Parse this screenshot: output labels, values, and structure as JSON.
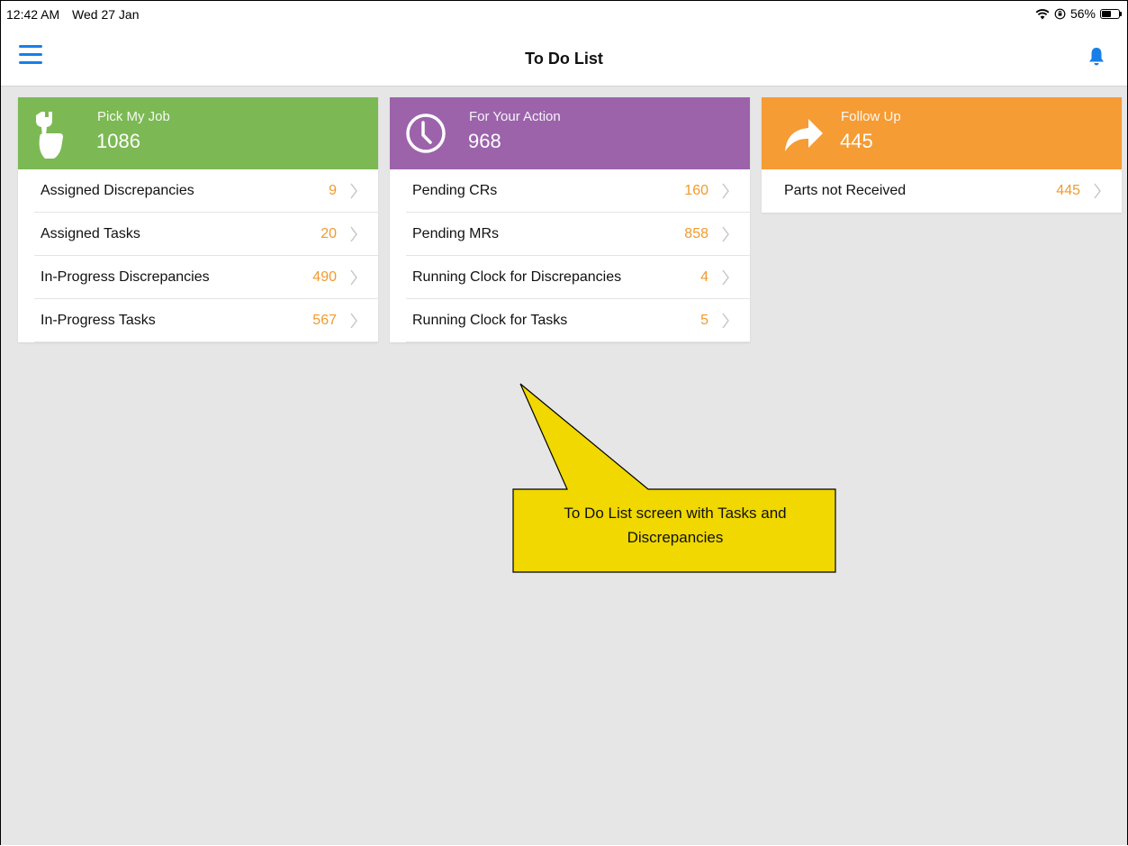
{
  "status_bar": {
    "time": "12:42 AM",
    "date": "Wed 27 Jan",
    "battery_text": "56%",
    "battery_level": 0.56
  },
  "nav": {
    "title": "To Do List",
    "menu_icon": "hamburger-menu-icon",
    "bell_icon": "bell-icon",
    "accent": "#1680e8"
  },
  "cards": [
    {
      "label": "Pick My Job",
      "count": "1086",
      "color": "#7cb954",
      "icon": "wrench-hand-icon",
      "rows": [
        {
          "label": "Assigned Discrepancies",
          "value": "9"
        },
        {
          "label": "Assigned Tasks",
          "value": "20"
        },
        {
          "label": "In-Progress Discrepancies",
          "value": "490"
        },
        {
          "label": "In-Progress Tasks",
          "value": "567"
        }
      ]
    },
    {
      "label": "For Your Action",
      "count": "968",
      "color": "#9c63ab",
      "icon": "clock-icon",
      "rows": [
        {
          "label": "Pending CRs",
          "value": "160"
        },
        {
          "label": "Pending MRs",
          "value": "858"
        },
        {
          "label": "Running Clock for Discrepancies",
          "value": "4"
        },
        {
          "label": "Running Clock for Tasks",
          "value": "5"
        }
      ]
    },
    {
      "label": "Follow Up",
      "count": "445",
      "color": "#f59c34",
      "icon": "forward-arrow-icon",
      "rows": [
        {
          "label": "Parts not Received",
          "value": "445"
        }
      ]
    }
  ],
  "callout": {
    "text": "To Do List screen with Tasks and Discrepancies",
    "color": "#f0d800"
  },
  "value_color": "#f29a2e"
}
